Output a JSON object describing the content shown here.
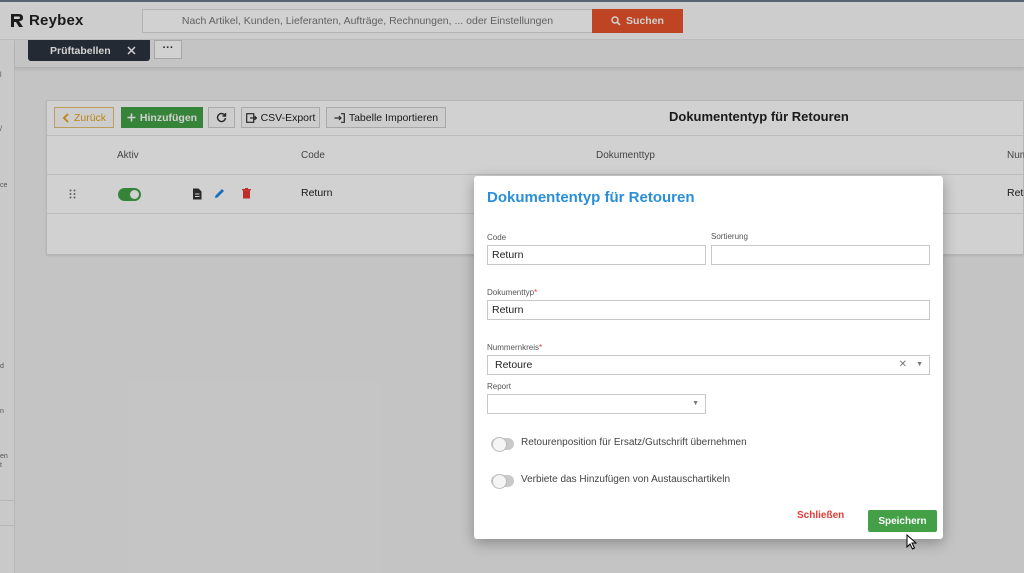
{
  "app": {
    "name": "Reybex"
  },
  "search": {
    "placeholder": "Nach Artikel, Kunden, Lieferanten, Aufträge, Rechnungen, ... oder Einstellungen",
    "button_label": "Suchen"
  },
  "sidebar": {
    "fragments": [
      "l",
      "/",
      "ce",
      "d",
      "n",
      "en",
      "t"
    ]
  },
  "tabs": {
    "active_label": "Prüftabellen",
    "more_label": "···"
  },
  "toolbar": {
    "back_label": "Zurück",
    "add_label": "Hinzufügen",
    "csv_label": "CSV-Export",
    "import_label": "Tabelle Importieren"
  },
  "page": {
    "title": "Dokumententyp für Retouren"
  },
  "table": {
    "headers": {
      "active": "Aktiv",
      "code": "Code",
      "doctype": "Dokumenttyp",
      "number": "Num"
    },
    "row": {
      "code": "Return",
      "number": "Retc"
    }
  },
  "modal": {
    "title": "Dokumententyp für Retouren",
    "code_label": "Code",
    "code_value": "Return",
    "sort_label": "Sortierung",
    "sort_value": "",
    "doctype_label": "Dokumenttyp",
    "doctype_value": "Return",
    "numkreis_label": "Nummernkreis",
    "numkreis_value": "Retoure",
    "report_label": "Report",
    "report_value": "",
    "switch1_label": "Retourenposition für Ersatz/Gutschrift übernehmen",
    "switch2_label": "Verbiete das Hinzufügen von Austauschartikeln",
    "close_label": "Schließen",
    "save_label": "Speichern"
  },
  "colors": {
    "accent": "#2a8fd8",
    "primary_green": "#43a047",
    "search_orange": "#e8542c",
    "danger": "#e53935"
  }
}
